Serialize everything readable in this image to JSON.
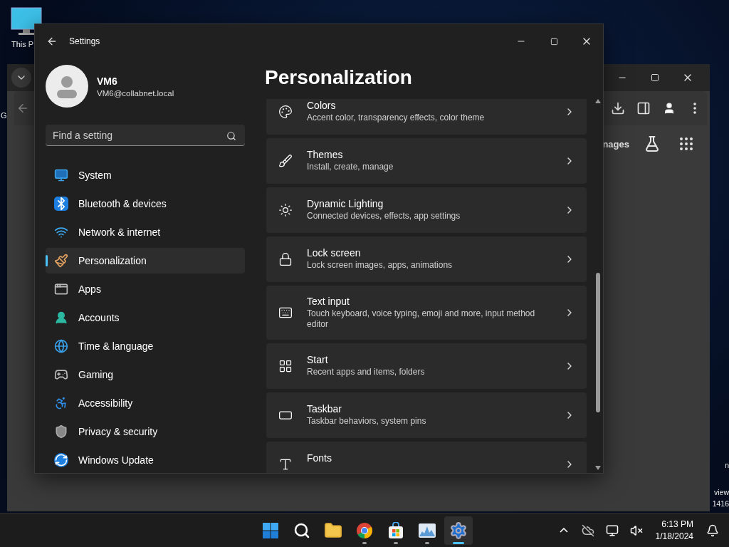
{
  "desktop": {
    "icon_label": "This P",
    "edge_text": "G",
    "corner_texts": [
      "n",
      "view",
      "1416"
    ]
  },
  "browser": {
    "partial_text": "nages"
  },
  "settings": {
    "title": "Settings",
    "user": {
      "name": "VM6",
      "email": "VM6@collabnet.local"
    },
    "search": {
      "placeholder": "Find a setting"
    },
    "nav": [
      {
        "label": "System",
        "selected": false
      },
      {
        "label": "Bluetooth & devices",
        "selected": false
      },
      {
        "label": "Network & internet",
        "selected": false
      },
      {
        "label": "Personalization",
        "selected": true
      },
      {
        "label": "Apps",
        "selected": false
      },
      {
        "label": "Accounts",
        "selected": false
      },
      {
        "label": "Time & language",
        "selected": false
      },
      {
        "label": "Gaming",
        "selected": false
      },
      {
        "label": "Accessibility",
        "selected": false
      },
      {
        "label": "Privacy & security",
        "selected": false
      },
      {
        "label": "Windows Update",
        "selected": false
      }
    ],
    "page_title": "Personalization",
    "cards": [
      {
        "title": "Colors",
        "subtitle": "Accent color, transparency effects, color theme"
      },
      {
        "title": "Themes",
        "subtitle": "Install, create, manage"
      },
      {
        "title": "Dynamic Lighting",
        "subtitle": "Connected devices, effects, app settings"
      },
      {
        "title": "Lock screen",
        "subtitle": "Lock screen images, apps, animations"
      },
      {
        "title": "Text input",
        "subtitle": "Touch keyboard, voice typing, emoji and more, input method editor"
      },
      {
        "title": "Start",
        "subtitle": "Recent apps and items, folders"
      },
      {
        "title": "Taskbar",
        "subtitle": "Taskbar behaviors, system pins"
      },
      {
        "title": "Fonts"
      }
    ]
  },
  "taskbar": {
    "apps": [
      {
        "running": false,
        "selected": false
      },
      {
        "running": false,
        "selected": false
      },
      {
        "running": false,
        "selected": false
      },
      {
        "running": true,
        "selected": false
      },
      {
        "running": true,
        "selected": false
      },
      {
        "running": true,
        "selected": false
      },
      {
        "running": true,
        "selected": true
      }
    ],
    "clock": {
      "time": "6:13 PM",
      "date": "1/18/2024"
    }
  }
}
